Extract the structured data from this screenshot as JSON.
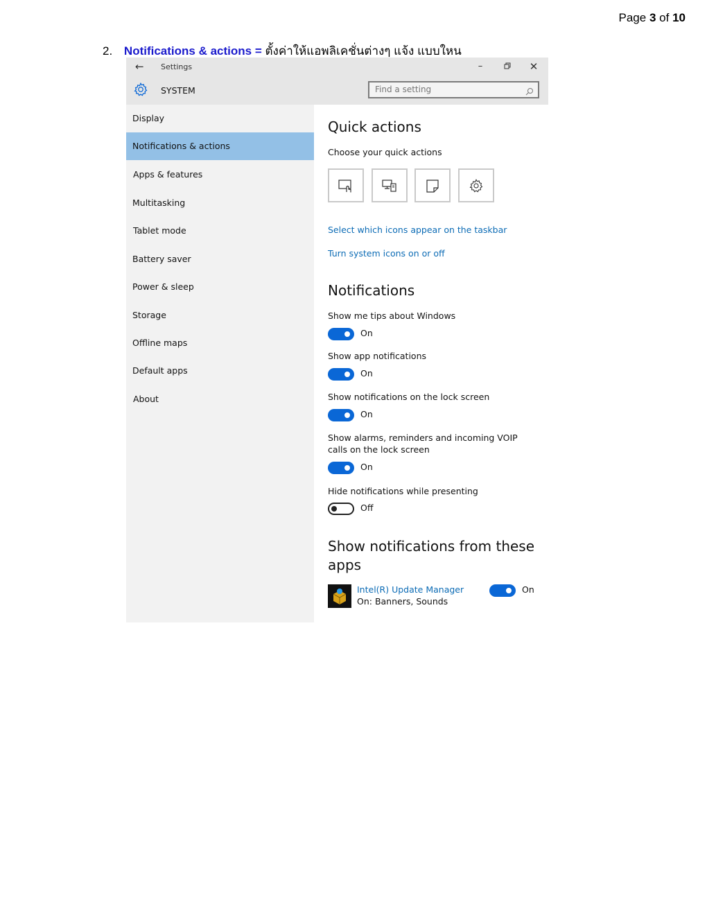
{
  "page": {
    "prefix": "Page",
    "current": "3",
    "of": "of",
    "total": "10"
  },
  "heading": {
    "number": "2.",
    "title": "Notifications & actions =",
    "description": "ตั้งค่าให้แอพลิเคชั่นต่างๆ แจ้ง แบบใหน"
  },
  "window": {
    "title": "Settings",
    "section": "SYSTEM",
    "search_placeholder": "Find a setting",
    "controls": [
      "minimize",
      "restore",
      "close"
    ]
  },
  "sidebar": {
    "items": [
      {
        "label": "Display",
        "active": false
      },
      {
        "label": "Notifications & actions",
        "active": true
      },
      {
        "label": "Apps & features",
        "active": false
      },
      {
        "label": "Multitasking",
        "active": false
      },
      {
        "label": "Tablet mode",
        "active": false
      },
      {
        "label": "Battery saver",
        "active": false
      },
      {
        "label": "Power & sleep",
        "active": false
      },
      {
        "label": "Storage",
        "active": false
      },
      {
        "label": "Offline maps",
        "active": false
      },
      {
        "label": "Default apps",
        "active": false
      },
      {
        "label": "About",
        "active": false
      }
    ]
  },
  "quick_actions": {
    "title": "Quick actions",
    "subtitle": "Choose your quick actions",
    "tiles": [
      "tablet-mode-icon",
      "connect-icon",
      "note-icon",
      "settings-icon"
    ],
    "link1": "Select which icons appear on the taskbar",
    "link2": "Turn system icons on or off"
  },
  "notifications": {
    "title": "Notifications",
    "settings": [
      {
        "label": "Show me tips about Windows",
        "state": "On"
      },
      {
        "label": "Show app notifications",
        "state": "On"
      },
      {
        "label": "Show notifications on the lock screen",
        "state": "On"
      },
      {
        "label": "Show alarms, reminders and incoming VOIP calls on the lock screen",
        "state": "On"
      },
      {
        "label": "Hide notifications while presenting",
        "state": "Off"
      }
    ]
  },
  "apps_section": {
    "title": "Show notifications from these apps",
    "apps": [
      {
        "name": "Intel(R) Update Manager",
        "detail": "On: Banners, Sounds",
        "state": "On"
      }
    ]
  },
  "colors": {
    "accent": "#0a67d6",
    "selected": "#93c0e6",
    "link": "#0b6bb5",
    "heading_blue": "#1a1acc"
  }
}
